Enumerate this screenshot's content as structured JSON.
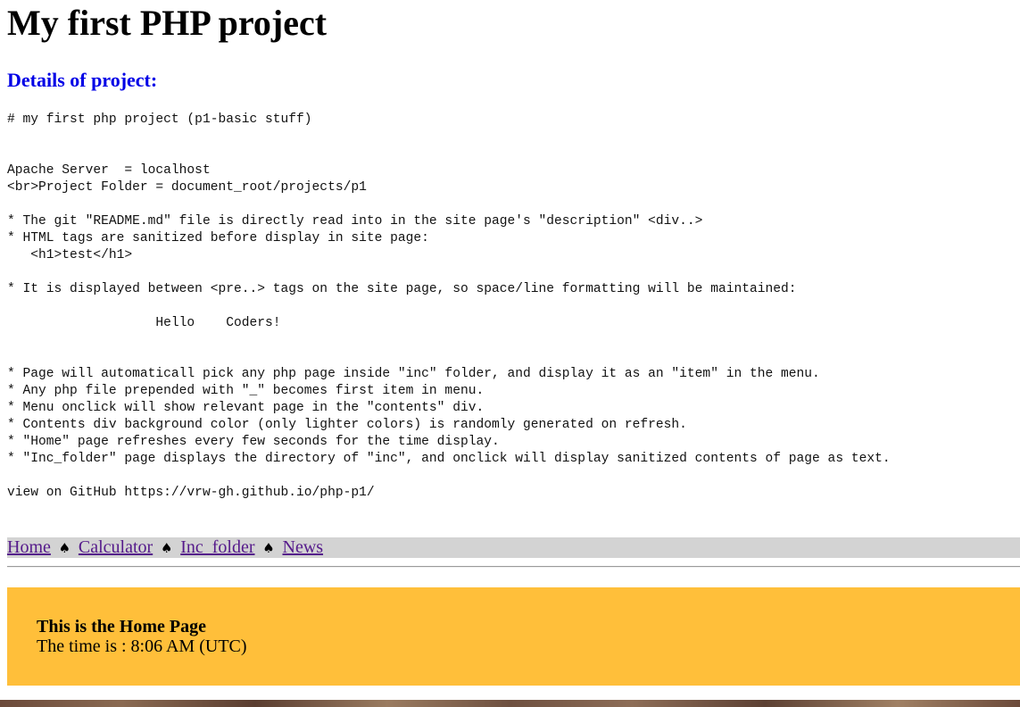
{
  "header": {
    "title": "My first PHP project",
    "details_heading": "Details of project:"
  },
  "description": {
    "lines": [
      "# my first php project (p1-basic stuff)",
      "",
      "",
      "Apache Server  = localhost",
      "<br>Project Folder = document_root/projects/p1",
      "",
      "* The git \"README.md\" file is directly read into in the site page's \"description\" <div..>",
      "* HTML tags are sanitized before display in site page:",
      "   <h1>test</h1>",
      "",
      "* It is displayed between <pre..> tags on the site page, so space/line formatting will be maintained:",
      "",
      "                   Hello    Coders!",
      "",
      "",
      "* Page will automaticall pick any php page inside \"inc\" folder, and display it as an \"item\" in the menu.",
      "* Any php file prepended with \"_\" becomes first item in menu.",
      "* Menu onclick will show relevant page in the \"contents\" div.",
      "* Contents div background color (only lighter colors) is randomly generated on refresh.",
      "* \"Home\" page refreshes every few seconds for the time display.",
      "* \"Inc_folder\" page displays the directory of \"inc\", and onclick will display sanitized contents of page as text.",
      "",
      "view on GitHub https://vrw-gh.github.io/php-p1/"
    ]
  },
  "menu": {
    "items": [
      {
        "label": "Home"
      },
      {
        "label": "Calculator"
      },
      {
        "label": "Inc_folder"
      },
      {
        "label": "News"
      }
    ],
    "separator": "♠",
    "separator_icon": "spade-icon"
  },
  "contents": {
    "heading": "This is the Home Page",
    "time_text": "The time is : 8:06 AM (UTC)",
    "background_color": "#ffbf3a"
  },
  "colors": {
    "details_heading": "#0000e6",
    "link": "#551a8b",
    "menu_bar": "#d3d3d3"
  }
}
